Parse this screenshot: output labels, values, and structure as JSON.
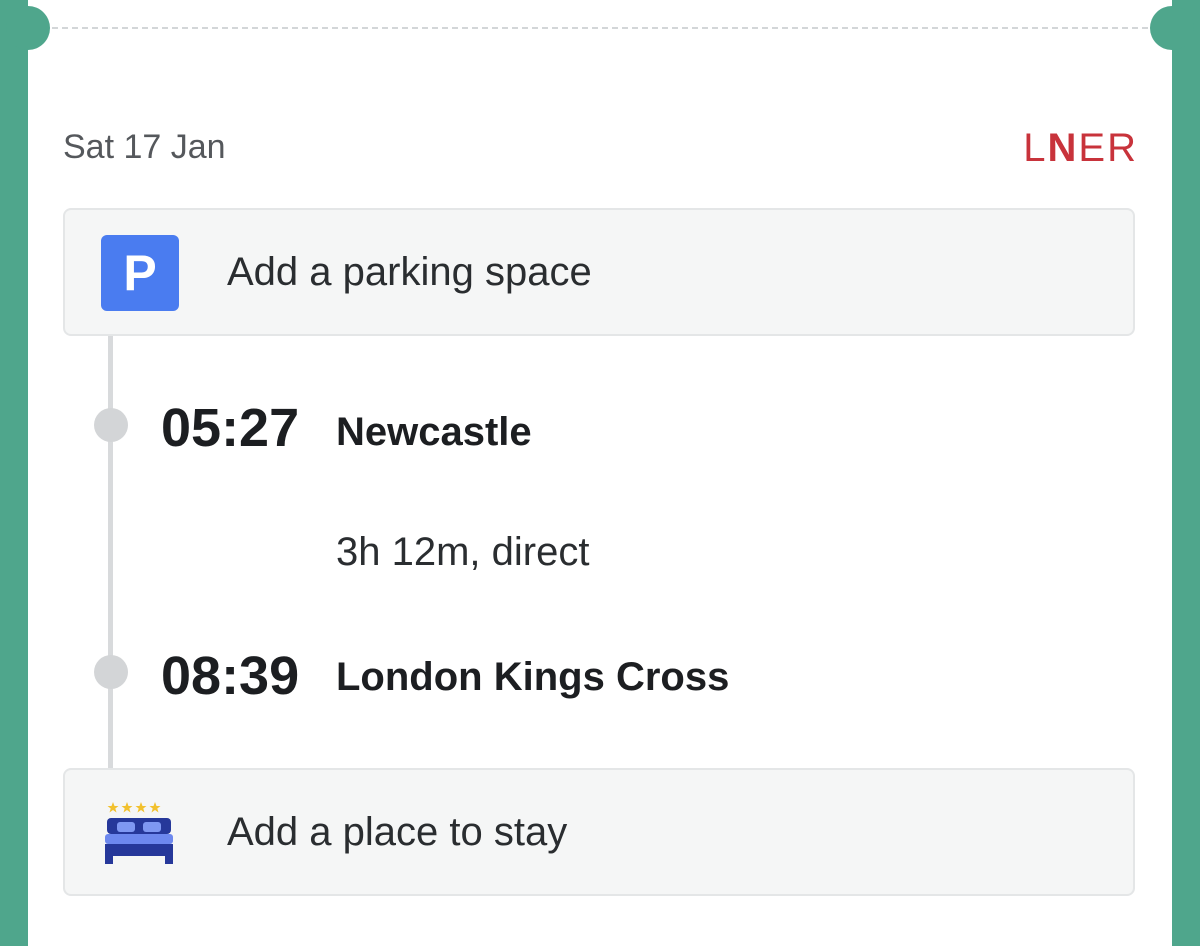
{
  "trip": {
    "date": "Sat 17 Jan",
    "operator_logo": {
      "l": "L",
      "n": "N",
      "e": "E",
      "r": "R"
    },
    "parking": {
      "icon_letter": "P",
      "label": "Add a parking space"
    },
    "departure": {
      "time": "05:27",
      "station": "Newcastle"
    },
    "duration": "3h 12m, direct",
    "arrival": {
      "time": "08:39",
      "station": "London Kings Cross"
    },
    "stay": {
      "label": "Add a place to stay"
    }
  },
  "colors": {
    "background": "#4fa68c",
    "logo": "#c8333b",
    "parking_icon": "#4a7cf0",
    "bed_icon": "#26389a"
  }
}
